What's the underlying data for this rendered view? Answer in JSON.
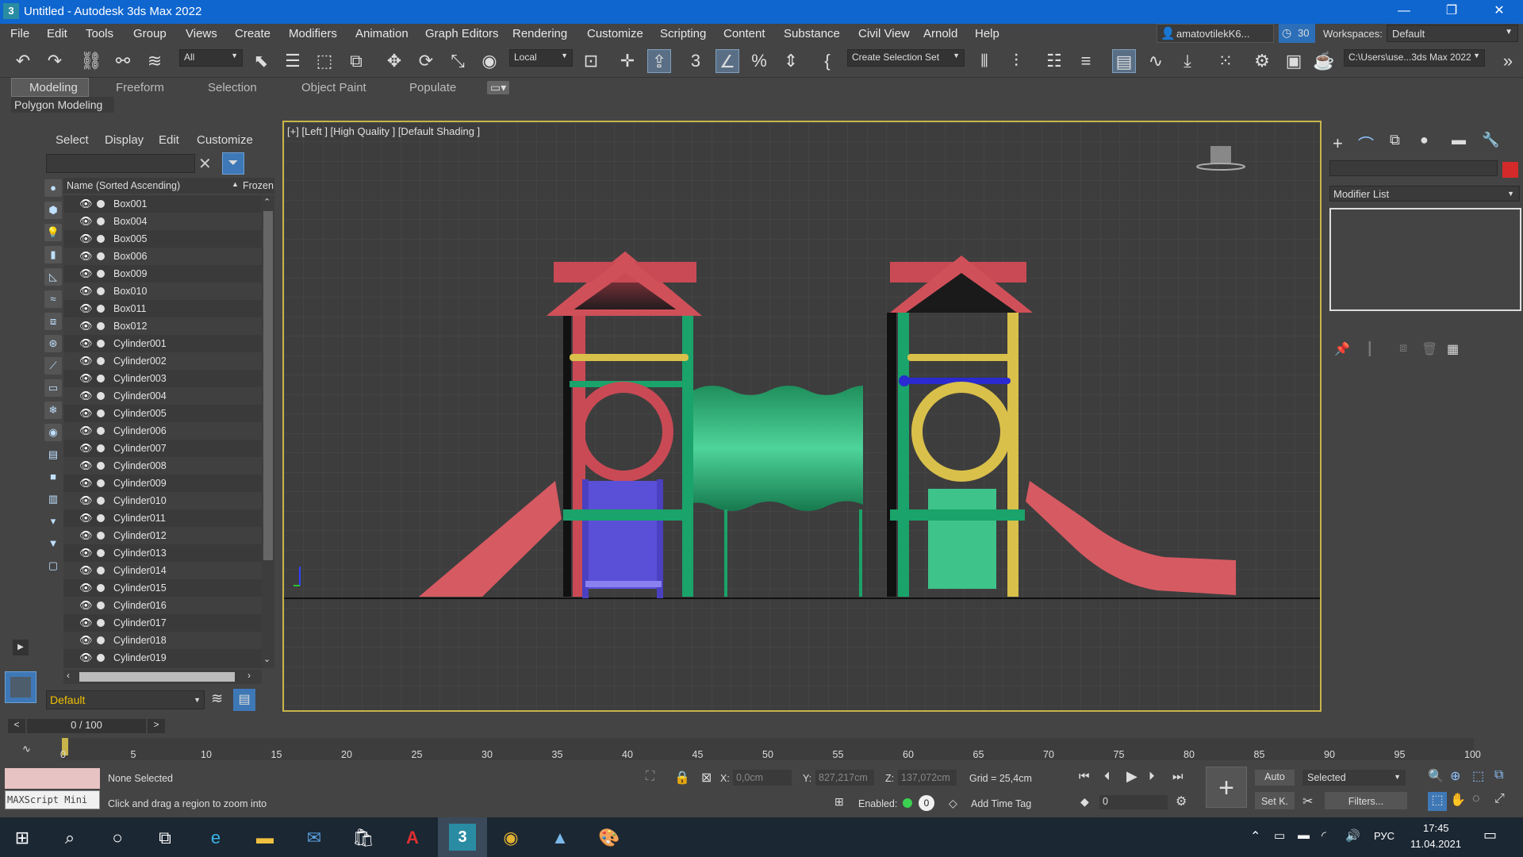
{
  "window": {
    "title": "Untitled - Autodesk 3ds Max 2022",
    "app_icon": "3",
    "minimize": "—",
    "restore": "❐",
    "close": "✕"
  },
  "menu": [
    "File",
    "Edit",
    "Tools",
    "Group",
    "Views",
    "Create",
    "Modifiers",
    "Animation",
    "Graph Editors",
    "Rendering",
    "Customize",
    "Scripting",
    "Content",
    "Substance",
    "Civil View",
    "Arnold",
    "Help"
  ],
  "account": {
    "user": "amatovtilekK6...",
    "count": "30",
    "workspaces_label": "Workspaces:",
    "workspace": "Default"
  },
  "toolbar": {
    "filter": "All",
    "coord_system": "Local",
    "selection_set": "Create Selection Set",
    "path": "C:\\Users\\use...3ds Max 2022"
  },
  "ribbon": {
    "tabs": [
      "Modeling",
      "Freeform",
      "Selection",
      "Object Paint",
      "Populate"
    ],
    "active": "Modeling",
    "sub": "Polygon Modeling"
  },
  "scene_explorer": {
    "tabs": [
      "Select",
      "Display",
      "Edit",
      "Customize"
    ],
    "col_name": "Name (Sorted Ascending)",
    "col_frozen": "Frozen",
    "items": [
      "Box001",
      "Box004",
      "Box005",
      "Box006",
      "Box009",
      "Box010",
      "Box011",
      "Box012",
      "Cylinder001",
      "Cylinder002",
      "Cylinder003",
      "Cylinder004",
      "Cylinder005",
      "Cylinder006",
      "Cylinder007",
      "Cylinder008",
      "Cylinder009",
      "Cylinder010",
      "Cylinder011",
      "Cylinder012",
      "Cylinder013",
      "Cylinder014",
      "Cylinder015",
      "Cylinder016",
      "Cylinder017",
      "Cylinder018",
      "Cylinder019"
    ],
    "layer": "Default"
  },
  "viewport": {
    "label": "[+] [Left ] [High Quality ] [Default Shading ]"
  },
  "command_panel": {
    "modifier_list": "Modifier List"
  },
  "timeline": {
    "frame": "0 / 100",
    "ticks": [
      "0",
      "5",
      "10",
      "15",
      "20",
      "25",
      "30",
      "35",
      "40",
      "45",
      "50",
      "55",
      "60",
      "65",
      "70",
      "75",
      "80",
      "85",
      "90",
      "95",
      "100"
    ]
  },
  "status": {
    "maxscript": "MAXScript Mini",
    "selection": "None Selected",
    "prompt": "Click and drag a region to zoom into",
    "x_label": "X:",
    "x": "0,0cm",
    "y_label": "Y:",
    "y": "827,217cm",
    "z_label": "Z:",
    "z": "137,072cm",
    "grid": "Grid = 25,4cm",
    "enabled": "Enabled:",
    "enabled_val": "0",
    "add_time_tag": "Add Time Tag",
    "auto": "Auto",
    "selected": "Selected",
    "setk": "Set K.",
    "filters": "Filters...",
    "frame_field": "0"
  },
  "taskbar": {
    "lang": "РУС",
    "time": "17:45",
    "date": "11.04.2021"
  }
}
